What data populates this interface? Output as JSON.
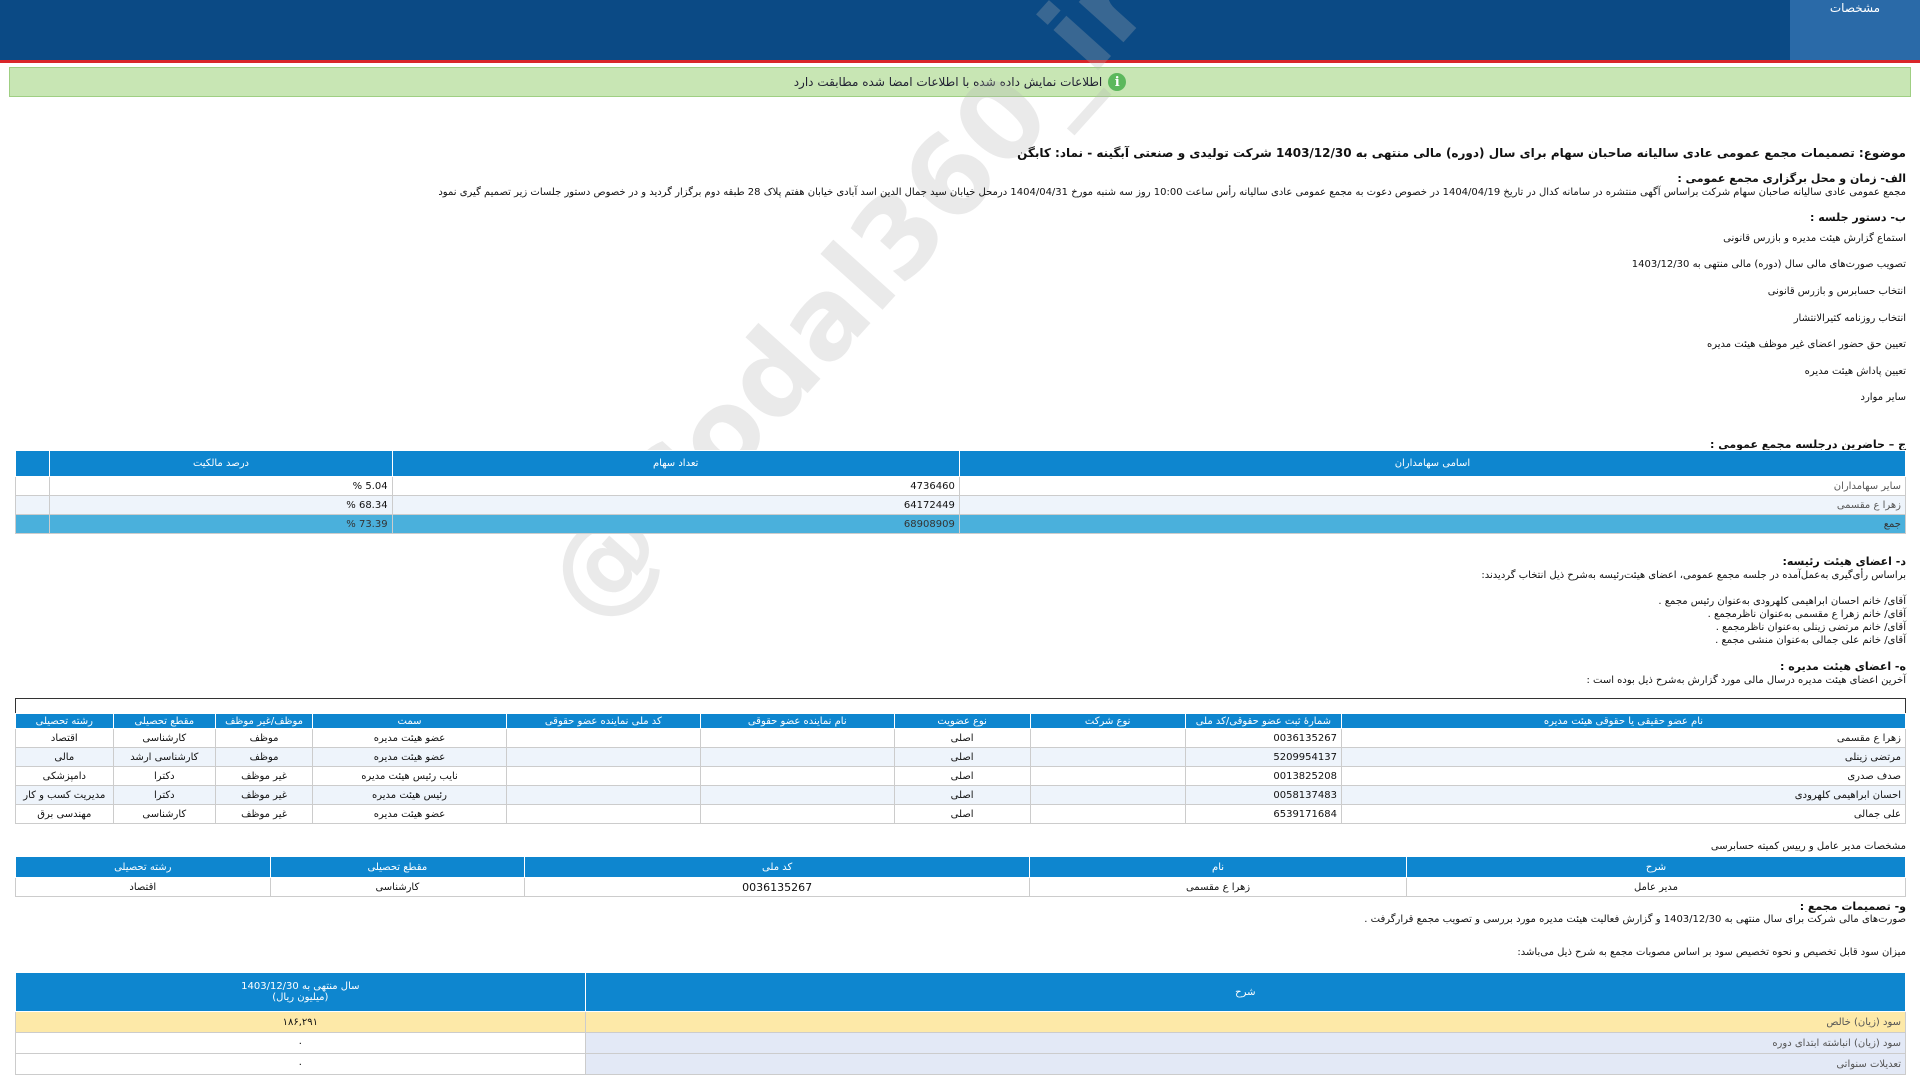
{
  "header": {
    "tab_label": "مشخصات"
  },
  "notice": {
    "text": "اطلاعات نمایش داده شده با اطلاعات امضا شده مطابقت دارد"
  },
  "watermark": "@Codal360_ir",
  "subject": "موضوع: تصمیمات مجمع عمومی عادی سالیانه صاحبان سهام برای سال (دوره) مالی منتهی به 1403/12/30 شرکت تولیدی و صنعتی آبگینه - نماد: کابگن",
  "section_a": {
    "title": "الف- زمان و محل برگزاری مجمع عمومی :",
    "text": "مجمع عمومی عادی سالیانه صاحبان سهام شرکت براساس آگهی منتشره در سامانه کدال در تاریخ 1404/04/19 در خصوص دعوت به مجمع عمومی عادی سالیانه رأس ساعت 10:00 روز سه شنبه مورخ 1404/04/31 درمحل  خیابان سید جمال الدین اسد آبادی خیابان هفتم پلاک 28 طبقه دوم   برگزار گردید و در خصوص دستور جلسات زیر تصمیم گیری نمود"
  },
  "section_b": {
    "title": "ب- دستور جلسه :",
    "items": [
      "استماع گزارش هیئت مدیره و بازرس قانونی",
      "تصویب صورت‌های مالی سال (دوره) مالی منتهی به 1403/12/30",
      "انتخاب حسابرس و بازرس قانونی",
      "انتخاب روزنامه کثیرالانتشار",
      "تعیین حق حضور اعضای غیر موظف هیئت مدیره",
      "تعیین پاداش هیئت مدیره",
      "سایر موارد"
    ]
  },
  "section_c": {
    "title": "ج – حاضرین درجلسه مجمع عمومی :",
    "headers": [
      "اسامی سهامداران",
      "تعداد سهام",
      "درصد مالکیت"
    ],
    "rows": [
      {
        "name": "سایر سهامداران",
        "shares": "4736460",
        "percent": "5.04 %"
      },
      {
        "name": "زهرا ع مقسمی",
        "shares": "64172449",
        "percent": "68.34 %"
      },
      {
        "name": "جمع",
        "shares": "68908909",
        "percent": "73.39 %"
      }
    ]
  },
  "section_d": {
    "title": "د- اعضای هیئت رئیسه:",
    "intro": "براساس رأی‌گیری به‌عمل‌آمده در جلسه مجمع عمومی، اعضای هیئت‌رئیسه به‌شرح ذیل انتخاب گردیدند:",
    "lines": [
      "آقای/ خانم  احسان ابراهیمی کلهرودی  به‌عنوان رئیس مجمع .",
      "آقای/ خانم  زهرا ع مقسمی  به‌عنوان ناظرمجمع .",
      "آقای/ خانم  مرتضی زینلی  به‌عنوان ناظرمجمع .",
      "آقای/ خانم  علی جمالی  به‌عنوان منشی مجمع ."
    ]
  },
  "section_e": {
    "title": "ه- اعضای هیئت مدیره :",
    "intro": "آخرین اعضای هیئت مدیره درسال مالی مورد گزارش به‌شرح ذیل بوده است :",
    "headers": [
      "نام عضو حقیقی یا حقوقی هیئت مدیره",
      "شمارهٔ ثبت عضو حقوقی/کد ملی",
      "نوع شرکت",
      "نوع عضویت",
      "نام نماینده عضو حقوقی",
      "کد ملی نماینده عضو حقوقی",
      "سمت",
      "موظف/غیر موظف",
      "مقطع تحصیلی",
      "رشته تحصیلی"
    ],
    "rows": [
      [
        "زهرا ع مقسمی",
        "0036135267",
        "",
        "اصلی",
        "",
        "",
        "عضو هیئت مدیره",
        "موظف",
        "کارشناسی",
        "اقتصاد"
      ],
      [
        "مرتضی زینلی",
        "5209954137",
        "",
        "اصلی",
        "",
        "",
        "عضو هیئت مدیره",
        "موظف",
        "کارشناسی ارشد",
        "مالی"
      ],
      [
        "صدف صدری",
        "0013825208",
        "",
        "اصلی",
        "",
        "",
        "نایب رئیس هیئت مدیره",
        "غیر موظف",
        "دکترا",
        "دامپزشکی"
      ],
      [
        "احسان ابراهیمی کلهرودی",
        "0058137483",
        "",
        "اصلی",
        "",
        "",
        "رئیس هیئت مدیره",
        "غیر موظف",
        "دکترا",
        "مدیریت کسب و کار"
      ],
      [
        "علی جمالی",
        "6539171684",
        "",
        "اصلی",
        "",
        "",
        "عضو هیئت مدیره",
        "غیر موظف",
        "کارشناسی",
        "مهندسی برق"
      ]
    ]
  },
  "ceo": {
    "title": "مشخصات مدیر عامل و رییس کمیته حسابرسی",
    "headers": [
      "شرح",
      "نام",
      "کد ملی",
      "مقطع تحصیلی",
      "رشته تحصیلی"
    ],
    "row": [
      "مدیر عامل",
      "زهرا ع مقسمی",
      "0036135267",
      "کارشناسی",
      "اقتصاد"
    ]
  },
  "section_f": {
    "title": "و- تصمیمات مجمع :",
    "text1": "صورت‌های مالی شرکت برای سال منتهی به  1403/12/30 و گزارش فعالیت هیئت مدیره مورد بررسی و تصویب مجمع قرارگرفت .",
    "text2": "میزان سود قابل تخصیص و نحوه تخصیص سود بر اساس مصوبات مجمع به شرح ذیل می‌باشد:"
  },
  "profit": {
    "header_desc": "شرح",
    "header_year": "سال منتهی به 1403/12/30",
    "header_unit": "(میلیون ریال)",
    "rows": [
      {
        "desc": "سود (زیان) خالص",
        "value": "۱۸۶,۲۹۱"
      },
      {
        "desc": "سود (زیان) انباشته ابتدای دوره",
        "value": "۰"
      },
      {
        "desc": "تعدیلات سنواتی",
        "value": "۰"
      }
    ]
  },
  "colors": {
    "header_blue": "#0b4a85",
    "table_blue": "#0e86cf",
    "accent_red": "#d9262a",
    "notice_green": "#c8e6b4"
  }
}
